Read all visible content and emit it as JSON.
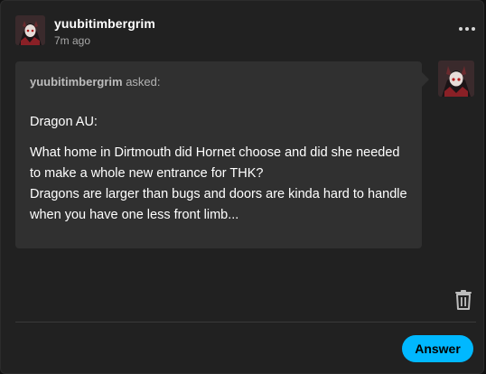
{
  "post": {
    "username": "yuubitimbergrim",
    "time": "7m ago",
    "more_icon": "more-horizontal-icon"
  },
  "ask": {
    "asker": "yuubitimbergrim",
    "asked_label": "asked:",
    "paragraphs": [
      "Dragon AU:",
      "What home in Dirtmouth did Hornet choose and did she needed to make a whole new entrance for THK?",
      "Dragons are larger than bugs and doors are kinda hard to handle when you have one less front limb..."
    ]
  },
  "actions": {
    "delete_icon": "trash-icon",
    "answer_label": "Answer"
  },
  "colors": {
    "background": "#212121",
    "ask_bubble": "#303030",
    "accent": "#00b8ff"
  }
}
